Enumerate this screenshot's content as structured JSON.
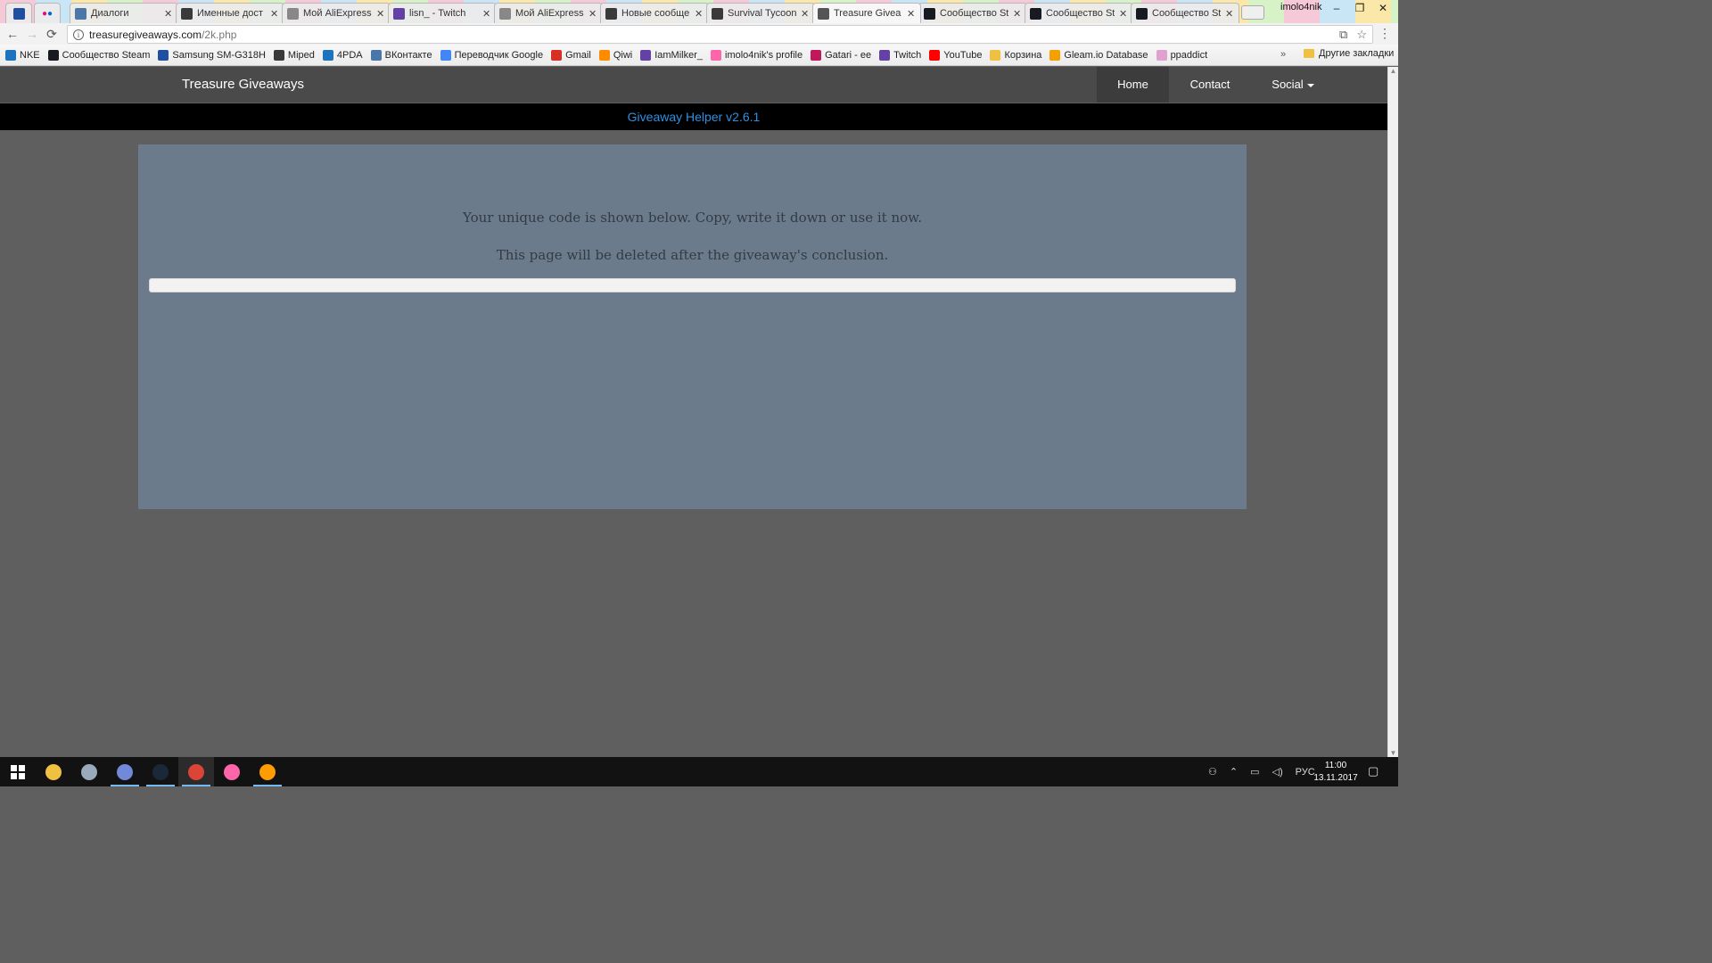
{
  "browser": {
    "tabs": [
      {
        "label": "Диалоги",
        "color": "#4a76a8",
        "active": false
      },
      {
        "label": "Именные дост",
        "color": "#3a3a3a",
        "active": false
      },
      {
        "label": "Мой AliExpress",
        "color": "#888888",
        "active": false
      },
      {
        "label": "lisn_ - Twitch",
        "color": "#6441a4",
        "active": false
      },
      {
        "label": "Мой AliExpress",
        "color": "#888888",
        "active": false
      },
      {
        "label": "Новые сообще",
        "color": "#3a3a3a",
        "active": false
      },
      {
        "label": "Survival Tycoon",
        "color": "#3a3a3a",
        "active": false
      },
      {
        "label": "Treasure Givea",
        "color": "#555555",
        "active": true
      },
      {
        "label": "Сообщество St",
        "color": "#171a21",
        "active": false
      },
      {
        "label": "Сообщество St",
        "color": "#171a21",
        "active": false
      },
      {
        "label": "Сообщество St",
        "color": "#171a21",
        "active": false
      }
    ],
    "tab_close_glyph": "✕",
    "profile_name": "imolo4nik",
    "window_controls": {
      "minimize": "–",
      "maximize": "❐",
      "close": "✕"
    },
    "nav": {
      "back": "←",
      "forward": "→",
      "reload": "⟳"
    },
    "url": {
      "host": "treasuregiveaways.com",
      "path": "/2k.php"
    },
    "omnibox_icons": {
      "translate": "⧉",
      "bookmark": "☆"
    },
    "menu_glyph": "⋮",
    "bookmarks": [
      {
        "label": "NKE",
        "color": "#1e73be"
      },
      {
        "label": "Сообщество Steam",
        "color": "#171a21"
      },
      {
        "label": "Samsung SM-G318H",
        "color": "#1e4fa0"
      },
      {
        "label": "Miped",
        "color": "#3a3a3a"
      },
      {
        "label": "4PDA",
        "color": "#1e73be"
      },
      {
        "label": "ВКонтакте",
        "color": "#4a76a8"
      },
      {
        "label": "Переводчик Google",
        "color": "#4285f4"
      },
      {
        "label": "Gmail",
        "color": "#d93025"
      },
      {
        "label": "Qiwi",
        "color": "#ff8c00"
      },
      {
        "label": "IamMilker_",
        "color": "#6441a4"
      },
      {
        "label": "imolo4nik's profile",
        "color": "#ff66aa"
      },
      {
        "label": "Gatari - ee",
        "color": "#c2185b"
      },
      {
        "label": "Twitch",
        "color": "#6441a4"
      },
      {
        "label": "YouTube",
        "color": "#ff0000"
      },
      {
        "label": "Корзина",
        "color": "#f0c040"
      },
      {
        "label": "Gleam.io Database",
        "color": "#f4a000"
      },
      {
        "label": "ppaddict",
        "color": "#e0a0d0"
      }
    ],
    "bookmarks_more": "»",
    "other_bookmarks": "Другие закладки"
  },
  "site": {
    "brand": "Treasure Giveaways",
    "nav": [
      {
        "label": "Home",
        "active": true
      },
      {
        "label": "Contact",
        "active": false
      },
      {
        "label": "Social",
        "active": false,
        "dropdown": true
      }
    ],
    "subbar": "Giveaway Helper v2.6.1",
    "message_line1": "Your unique code is shown below. Copy, write it down or use it now.",
    "message_line2": "This page will be deleted after the giveaway's conclusion.",
    "code_value": "",
    "scroll_up": "▲",
    "scroll_down": "▼"
  },
  "taskbar": {
    "apps": [
      {
        "name": "explorer",
        "color": "#f0c040",
        "open": false
      },
      {
        "name": "app-2",
        "color": "#9ab",
        "open": false
      },
      {
        "name": "discord",
        "color": "#7289da",
        "open": true
      },
      {
        "name": "steam",
        "color": "#1b2838",
        "open": true
      },
      {
        "name": "chrome",
        "color": "#db4437",
        "open": true,
        "active": true
      },
      {
        "name": "osu",
        "color": "#ff66aa",
        "open": false
      },
      {
        "name": "overwatch",
        "color": "#ff9c00",
        "open": true
      }
    ],
    "tray": {
      "people": "⚇",
      "chevron": "⌃",
      "network": "▭",
      "volume": "◁)",
      "lang": "РУС",
      "notifications": "▢"
    },
    "time": "11:00",
    "date": "13.11.2017"
  }
}
